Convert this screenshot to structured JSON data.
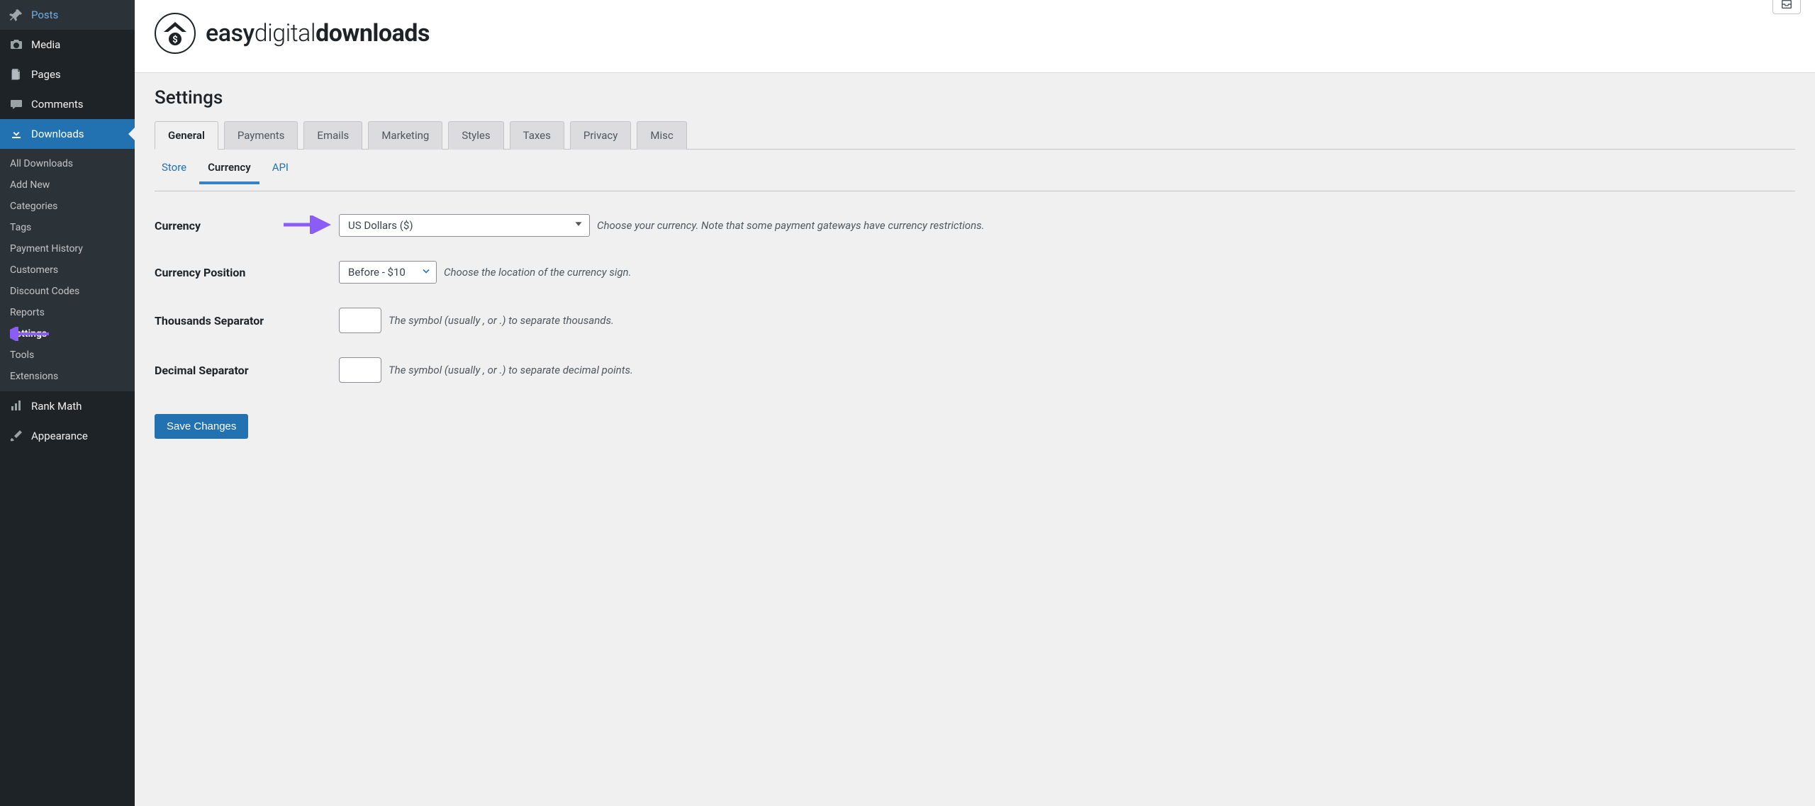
{
  "sidebar": {
    "items": [
      {
        "label": "Posts",
        "icon": "pin-icon"
      },
      {
        "label": "Media",
        "icon": "camera-icon"
      },
      {
        "label": "Pages",
        "icon": "pages-icon"
      },
      {
        "label": "Comments",
        "icon": "comment-icon"
      },
      {
        "label": "Downloads",
        "icon": "download-icon",
        "active": true
      },
      {
        "label": "Rank Math",
        "icon": "chart-icon"
      },
      {
        "label": "Appearance",
        "icon": "brush-icon"
      }
    ],
    "submenu": [
      {
        "label": "All Downloads"
      },
      {
        "label": "Add New"
      },
      {
        "label": "Categories"
      },
      {
        "label": "Tags"
      },
      {
        "label": "Payment History"
      },
      {
        "label": "Customers"
      },
      {
        "label": "Discount Codes"
      },
      {
        "label": "Reports"
      },
      {
        "label": "Settings",
        "active": true
      },
      {
        "label": "Tools"
      },
      {
        "label": "Extensions"
      }
    ]
  },
  "brand": {
    "name_light": "easy",
    "name_mid": "digital",
    "name_bold": "downloads"
  },
  "page": {
    "title": "Settings"
  },
  "tabs": [
    {
      "label": "General",
      "active": true
    },
    {
      "label": "Payments"
    },
    {
      "label": "Emails"
    },
    {
      "label": "Marketing"
    },
    {
      "label": "Styles"
    },
    {
      "label": "Taxes"
    },
    {
      "label": "Privacy"
    },
    {
      "label": "Misc"
    }
  ],
  "subtabs": [
    {
      "label": "Store"
    },
    {
      "label": "Currency",
      "active": true
    },
    {
      "label": "API"
    }
  ],
  "fields": {
    "currency": {
      "label": "Currency",
      "value": "US Dollars ($)",
      "desc": "Choose your currency. Note that some payment gateways have currency restrictions."
    },
    "currency_position": {
      "label": "Currency Position",
      "value": "Before - $10",
      "desc": "Choose the location of the currency sign."
    },
    "thousands": {
      "label": "Thousands Separator",
      "value": "",
      "desc": "The symbol (usually , or .) to separate thousands."
    },
    "decimal": {
      "label": "Decimal Separator",
      "value": "",
      "desc": "The symbol (usually , or .) to separate decimal points."
    }
  },
  "buttons": {
    "save": "Save Changes"
  },
  "colors": {
    "accent": "#2271b1",
    "arrow": "#8b5cf6"
  }
}
